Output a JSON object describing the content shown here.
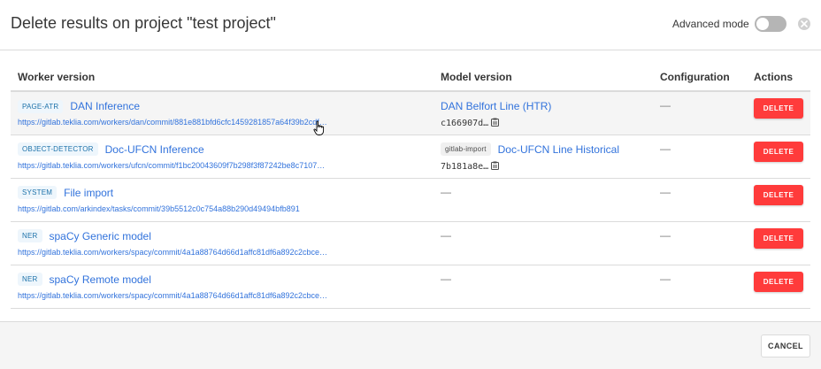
{
  "modal": {
    "title": "Delete results on project \"test project\"",
    "advanced_mode_label": "Advanced mode",
    "advanced_mode_on": false
  },
  "table": {
    "headers": {
      "worker": "Worker version",
      "model": "Model version",
      "config": "Configuration",
      "actions": "Actions"
    },
    "rows": [
      {
        "tag": "PAGE-ATR",
        "name": "DAN Inference",
        "url": "https://gitlab.teklia.com/workers/dan/commit/881e881bfd6cfc1459281857a64f39b2cdf…",
        "model_tag": "",
        "model_name": "DAN Belfort Line (HTR)",
        "model_hash": "c166907d…",
        "config": "—",
        "action": "DELETE"
      },
      {
        "tag": "OBJECT-DETECTOR",
        "name": "Doc-UFCN Inference",
        "url": "https://gitlab.teklia.com/workers/ufcn/commit/f1bc20043609f7b298f3f87242be8c7107…",
        "model_tag": "gitlab-import",
        "model_name": "Doc-UFCN Line Historical",
        "model_hash": "7b181a8e…",
        "config": "—",
        "action": "DELETE"
      },
      {
        "tag": "SYSTEM",
        "name": "File import",
        "url": "https://gitlab.com/arkindex/tasks/commit/39b5512c0c754a88b290d49494bfb891",
        "model_dash": "—",
        "config": "—",
        "action": "DELETE"
      },
      {
        "tag": "NER",
        "name": "spaCy Generic model",
        "url": "https://gitlab.teklia.com/workers/spacy/commit/4a1a88764d66d1affc81df6a892c2cbce…",
        "model_dash": "—",
        "config": "—",
        "action": "DELETE"
      },
      {
        "tag": "NER",
        "name": "spaCy Remote model",
        "url": "https://gitlab.teklia.com/workers/spacy/commit/4a1a88764d66d1affc81df6a892c2cbce…",
        "model_dash": "—",
        "config": "—",
        "action": "DELETE"
      }
    ]
  },
  "footer": {
    "cancel_label": "CANCEL"
  },
  "icons": {
    "close": "close-icon",
    "copy": "clipboard-icon",
    "cursor": "hand-pointer-icon"
  },
  "colors": {
    "link": "#3273dc",
    "danger": "#ff3b3b",
    "tag_bg": "#eef6fc",
    "tag_text": "#1d72aa"
  }
}
